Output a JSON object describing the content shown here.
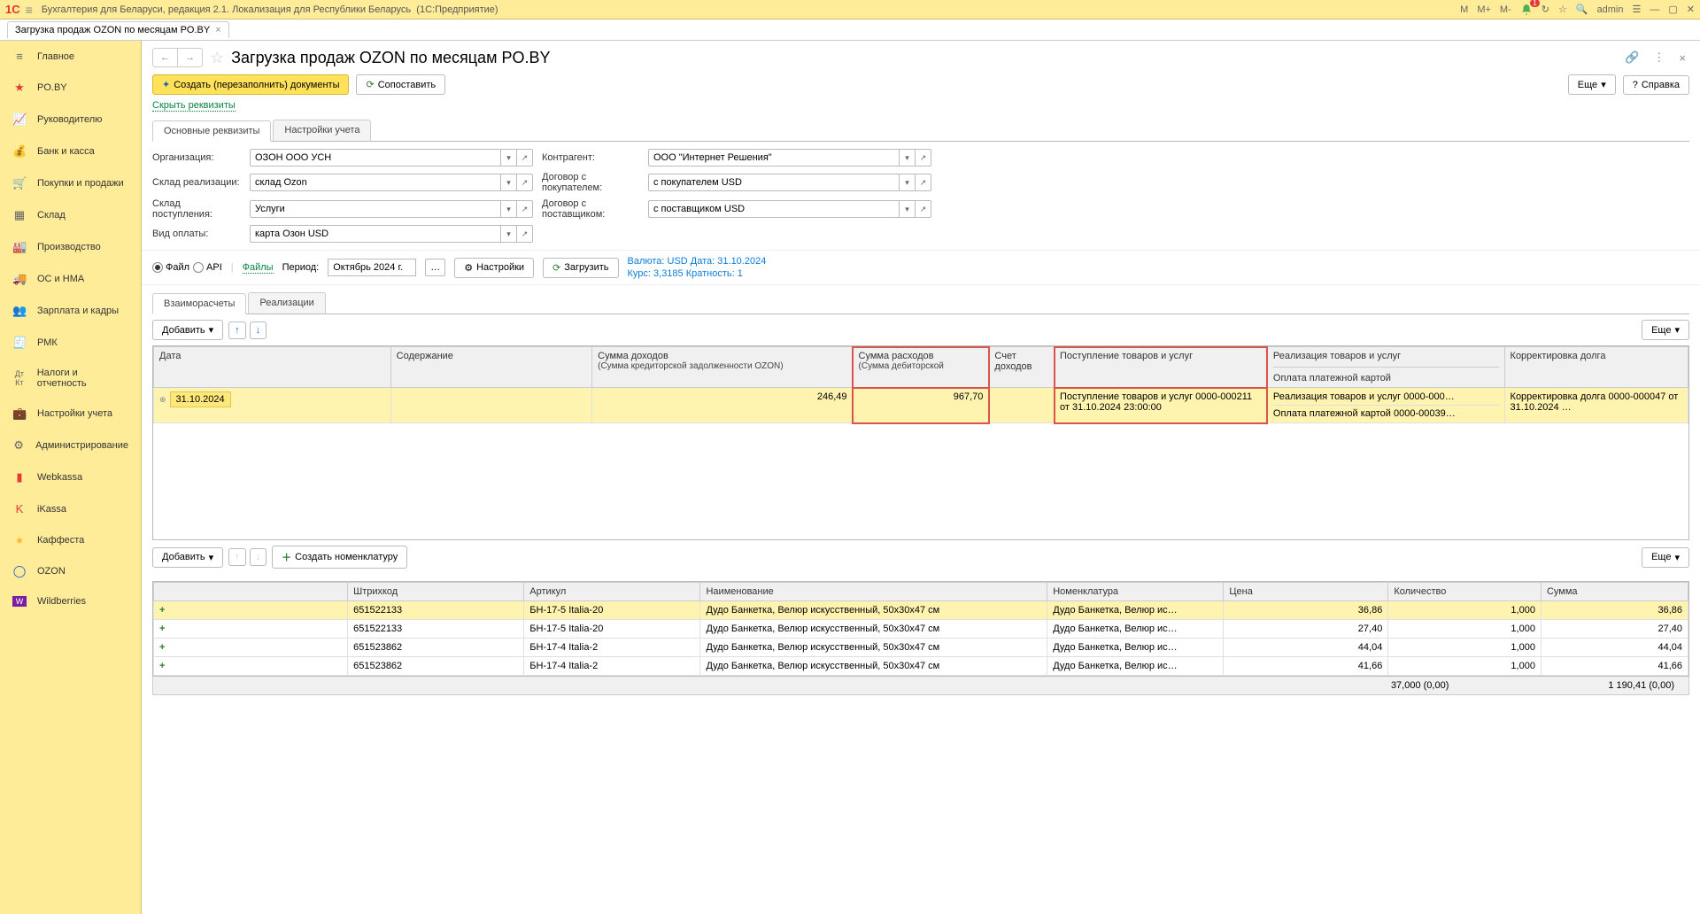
{
  "titlebar": {
    "app": "Бухгалтерия для Беларуси, редакция 2.1. Локализация для Республики Беларусь",
    "platform": "(1С:Предприятие)",
    "m": "M",
    "mplus": "M+",
    "mminus": "M-",
    "bell_badge": "1",
    "user": "admin"
  },
  "file_tab": {
    "label": "Загрузка продаж OZON по месяцам PO.BY"
  },
  "sidebar": {
    "items": [
      {
        "label": "Главное"
      },
      {
        "label": "PO.BY"
      },
      {
        "label": "Руководителю"
      },
      {
        "label": "Банк и касса"
      },
      {
        "label": "Покупки и продажи"
      },
      {
        "label": "Склад"
      },
      {
        "label": "Производство"
      },
      {
        "label": "ОС и НМА"
      },
      {
        "label": "Зарплата и кадры"
      },
      {
        "label": "РМК"
      },
      {
        "label": "Налоги и отчетность"
      },
      {
        "label": "Настройки учета"
      },
      {
        "label": "Администрирование"
      },
      {
        "label": "Webkassa"
      },
      {
        "label": "iKassa"
      },
      {
        "label": "Каффеста"
      },
      {
        "label": "OZON"
      },
      {
        "label": "Wildberries"
      }
    ]
  },
  "page": {
    "title": "Загрузка продаж OZON по месяцам PO.BY",
    "create_btn": "Создать (перезаполнить) документы",
    "compare_btn": "Сопоставить",
    "more_btn": "Еще",
    "help_btn": "Справка",
    "hide_req": "Скрыть реквизиты"
  },
  "tabs_top": {
    "t1": "Основные реквизиты",
    "t2": "Настройки учета"
  },
  "form": {
    "l_org": "Организация:",
    "v_org": "ОЗОН ООО УСН",
    "l_skr": "Склад реализации:",
    "v_skr": "склад Ozon",
    "l_skp": "Склад поступления:",
    "v_skp": "Услуги",
    "l_pay": "Вид оплаты:",
    "v_pay": "карта Озон USD",
    "l_kont": "Контрагент:",
    "v_kont": "ООО \"Интернет Решения\"",
    "l_dpok": "Договор с покупателем:",
    "v_dpok": "с покупателем USD",
    "l_dpost": "Договор с поставщиком:",
    "v_dpost": "с поставщиком USD"
  },
  "period": {
    "r_file": "Файл",
    "r_api": "API",
    "files_link": "Файлы",
    "label": "Период:",
    "value": "Октябрь 2024 г.",
    "settings_btn": "Настройки",
    "load_btn": "Загрузить",
    "currency_line1": "Валюта: USD Дата: 31.10.2024",
    "currency_line2": "Курс: 3,3185 Кратность: 1"
  },
  "tabs_data": {
    "t1": "Взаиморасчеты",
    "t2": "Реализации"
  },
  "top_toolbar": {
    "add": "Добавить",
    "more": "Еще"
  },
  "columns1": {
    "c1": "Дата",
    "c2": "Содержание",
    "c3a": "Сумма доходов",
    "c3b": "(Сумма кредиторской задолженности OZON)",
    "c4a": "Сумма расходов",
    "c4b": "(Сумма дебиторской",
    "c5": "Счет доходов",
    "c6": "Поступление товаров и услуг",
    "c7a": "Реализация товаров и услуг",
    "c7b": "Оплата платежной картой",
    "c8": "Корректировка долга"
  },
  "row1": {
    "date": "31.10.2024",
    "income": "246,49",
    "expense": "967,70",
    "receipt": "Поступление товаров и услуг 0000-000211 от 31.10.2024 23:00:00",
    "real_a": "Реализация товаров и услуг 0000-000…",
    "real_b": "Оплата платежной картой 0000-00039…",
    "corr": "Корректировка долга 0000-000047 от 31.10.2024 …"
  },
  "bottom_toolbar": {
    "add": "Добавить",
    "create_nom": "Создать номенклатуру",
    "more": "Еще"
  },
  "columns2": {
    "c1": "Штрихкод",
    "c2": "Артикул",
    "c3": "Наименование",
    "c4": "Номенклатура",
    "c5": "Цена",
    "c6": "Количество",
    "c7": "Сумма"
  },
  "rows2": [
    {
      "bc": "651522133",
      "art": "БН-17-5 Italia-20",
      "name": "Дудо Банкетка, Велюр искусственный, 50x30x47 см",
      "nom": "Дудо Банкетка, Велюр ис…",
      "price": "36,86",
      "qty": "1,000",
      "sum": "36,86"
    },
    {
      "bc": "651522133",
      "art": "БН-17-5 Italia-20",
      "name": "Дудо Банкетка, Велюр искусственный, 50x30x47 см",
      "nom": "Дудо Банкетка, Велюр ис…",
      "price": "27,40",
      "qty": "1,000",
      "sum": "27,40"
    },
    {
      "bc": "651523862",
      "art": "БН-17-4 Italia-2",
      "name": "Дудо Банкетка, Велюр искусственный, 50x30x47 см",
      "nom": "Дудо Банкетка, Велюр ис…",
      "price": "44,04",
      "qty": "1,000",
      "sum": "44,04"
    },
    {
      "bc": "651523862",
      "art": "БН-17-4 Italia-2",
      "name": "Дудо Банкетка, Велюр искусственный, 50x30x47 см",
      "nom": "Дудо Банкетка, Велюр ис…",
      "price": "41,66",
      "qty": "1,000",
      "sum": "41,66"
    }
  ],
  "totals": {
    "qty": "37,000 (0,00)",
    "sum": "1 190,41 (0,00)"
  }
}
